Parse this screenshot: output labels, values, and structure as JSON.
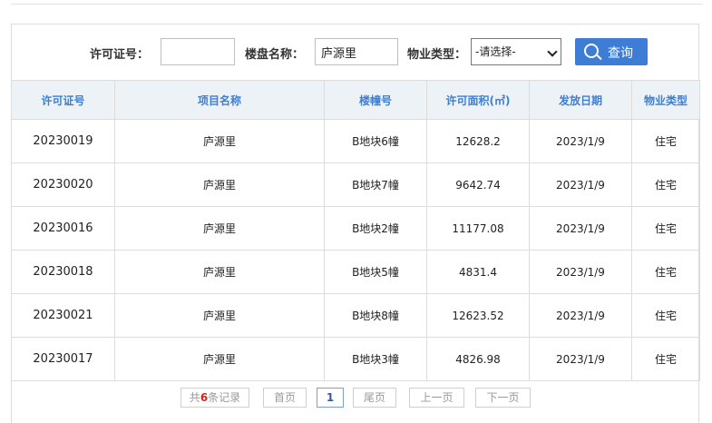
{
  "search": {
    "license_label": "许可证号：",
    "license_value": "",
    "project_label": "楼盘名称：",
    "project_value": "庐源里",
    "type_label": "物业类型：",
    "type_selected": "-请选择-",
    "query_button": "查询",
    "query_icon": "search-icon"
  },
  "table": {
    "headers": [
      "许可证号",
      "项目名称",
      "楼幢号",
      "许可面积(㎡)",
      "发放日期",
      "物业类型"
    ],
    "rows": [
      [
        "20230019",
        "庐源里",
        "B地块6幢",
        "12628.2",
        "2023/1/9",
        "住宅"
      ],
      [
        "20230020",
        "庐源里",
        "B地块7幢",
        "9642.74",
        "2023/1/9",
        "住宅"
      ],
      [
        "20230016",
        "庐源里",
        "B地块2幢",
        "11177.08",
        "2023/1/9",
        "住宅"
      ],
      [
        "20230018",
        "庐源里",
        "B地块5幢",
        "4831.4",
        "2023/1/9",
        "住宅"
      ],
      [
        "20230021",
        "庐源里",
        "B地块8幢",
        "12623.52",
        "2023/1/9",
        "住宅"
      ],
      [
        "20230017",
        "庐源里",
        "B地块3幢",
        "4826.98",
        "2023/1/9",
        "住宅"
      ]
    ]
  },
  "pager": {
    "total_prefix": "共",
    "total_count": "6",
    "total_suffix": "条记录",
    "first": "首页",
    "current_page": "1",
    "last": "尾页",
    "prev": "上一页",
    "next": "下一页"
  }
}
